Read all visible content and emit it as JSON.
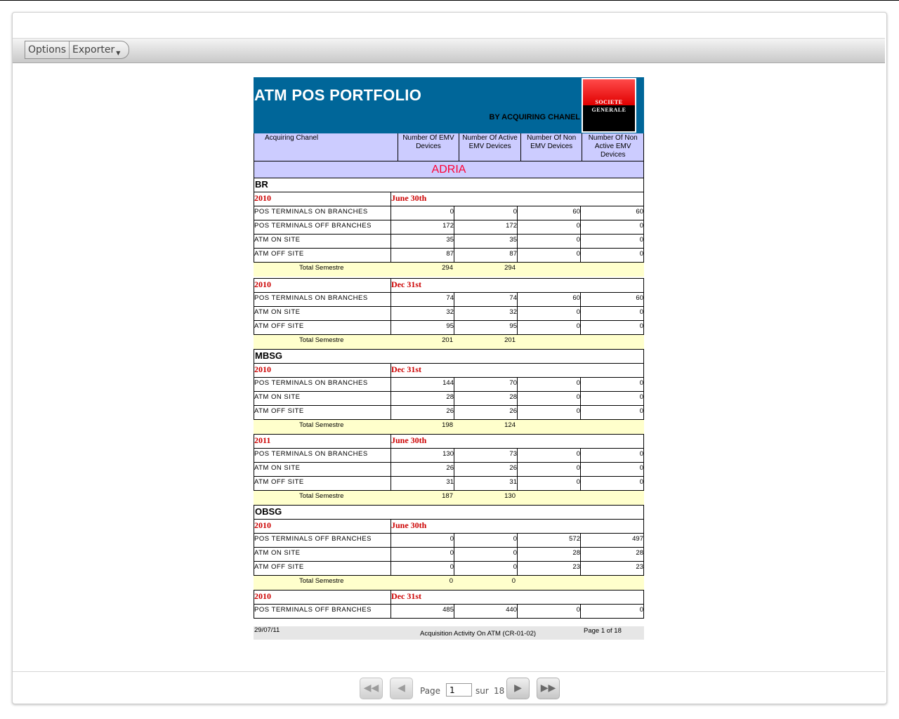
{
  "toolbar": {
    "options_label": "Options",
    "exporter_label": "Exporter"
  },
  "report": {
    "title": "ATM POS PORTFOLIO",
    "subtitle": "BY ACQUIRING CHANEL",
    "logo": {
      "line1": "SOCIETE",
      "line2": "GENERALE"
    },
    "columns": {
      "c0": "Acquiring Chanel",
      "c1": "Number Of EMV Devices",
      "c2": "Number Of Active EMV Devices",
      "c3": "Number Of Non EMV Devices",
      "c4": "Number Of Non Active EMV Devices"
    },
    "region": "ADRIA",
    "total_label": "Total Semestre",
    "groups": {
      "br": {
        "name": "BR",
        "p1": {
          "year": "2010",
          "date": "June 30th",
          "rows": [
            [
              "POS TERMINALS ON BRANCHES",
              "0",
              "0",
              "60",
              "60"
            ],
            [
              "POS TERMINALS OFF BRANCHES",
              "172",
              "172",
              "0",
              "0"
            ],
            [
              "ATM ON SITE",
              "35",
              "35",
              "0",
              "0"
            ],
            [
              "ATM OFF SITE",
              "87",
              "87",
              "0",
              "0"
            ]
          ],
          "total": [
            "294",
            "294"
          ]
        },
        "p2": {
          "year": "2010",
          "date": "Dec 31st",
          "rows": [
            [
              "POS TERMINALS ON BRANCHES",
              "74",
              "74",
              "60",
              "60"
            ],
            [
              "ATM ON SITE",
              "32",
              "32",
              "0",
              "0"
            ],
            [
              "ATM OFF SITE",
              "95",
              "95",
              "0",
              "0"
            ]
          ],
          "total": [
            "201",
            "201"
          ]
        }
      },
      "mbsg": {
        "name": "MBSG",
        "p1": {
          "year": "2010",
          "date": "Dec 31st",
          "rows": [
            [
              "POS TERMINALS ON BRANCHES",
              "144",
              "70",
              "0",
              "0"
            ],
            [
              "ATM ON SITE",
              "28",
              "28",
              "0",
              "0"
            ],
            [
              "ATM OFF SITE",
              "26",
              "26",
              "0",
              "0"
            ]
          ],
          "total": [
            "198",
            "124"
          ]
        },
        "p2": {
          "year": "2011",
          "date": "June 30th",
          "rows": [
            [
              "POS TERMINALS ON BRANCHES",
              "130",
              "73",
              "0",
              "0"
            ],
            [
              "ATM ON SITE",
              "26",
              "26",
              "0",
              "0"
            ],
            [
              "ATM OFF SITE",
              "31",
              "31",
              "0",
              "0"
            ]
          ],
          "total": [
            "187",
            "130"
          ]
        }
      },
      "obsg": {
        "name": "OBSG",
        "p1": {
          "year": "2010",
          "date": "June 30th",
          "rows": [
            [
              "POS TERMINALS OFF BRANCHES",
              "0",
              "0",
              "572",
              "497"
            ],
            [
              "ATM ON SITE",
              "0",
              "0",
              "28",
              "28"
            ],
            [
              "ATM OFF SITE",
              "0",
              "0",
              "23",
              "23"
            ]
          ],
          "total": [
            "0",
            "0"
          ]
        },
        "p2": {
          "year": "2010",
          "date": "Dec 31st",
          "rows": [
            [
              "POS TERMINALS OFF BRANCHES",
              "485",
              "440",
              "0",
              "0"
            ]
          ]
        }
      }
    },
    "footer": {
      "date": "29/07/11",
      "title": "Acquisition Activity On ATM (CR-01-02)",
      "page": "Page 1 of 18"
    }
  },
  "pager": {
    "page_label": "Page",
    "page_value": "1",
    "of_label": "sur",
    "total_pages": "18",
    "first_icon": "first-page-icon",
    "prev_icon": "prev-page-icon",
    "next_icon": "next-page-icon",
    "last_icon": "last-page-icon"
  },
  "colors": {
    "header_blue": "#006699",
    "column_header": "#ccccff",
    "region_text": "#ff0033",
    "period_text": "#cc0000",
    "total_row": "#ffffcc"
  }
}
